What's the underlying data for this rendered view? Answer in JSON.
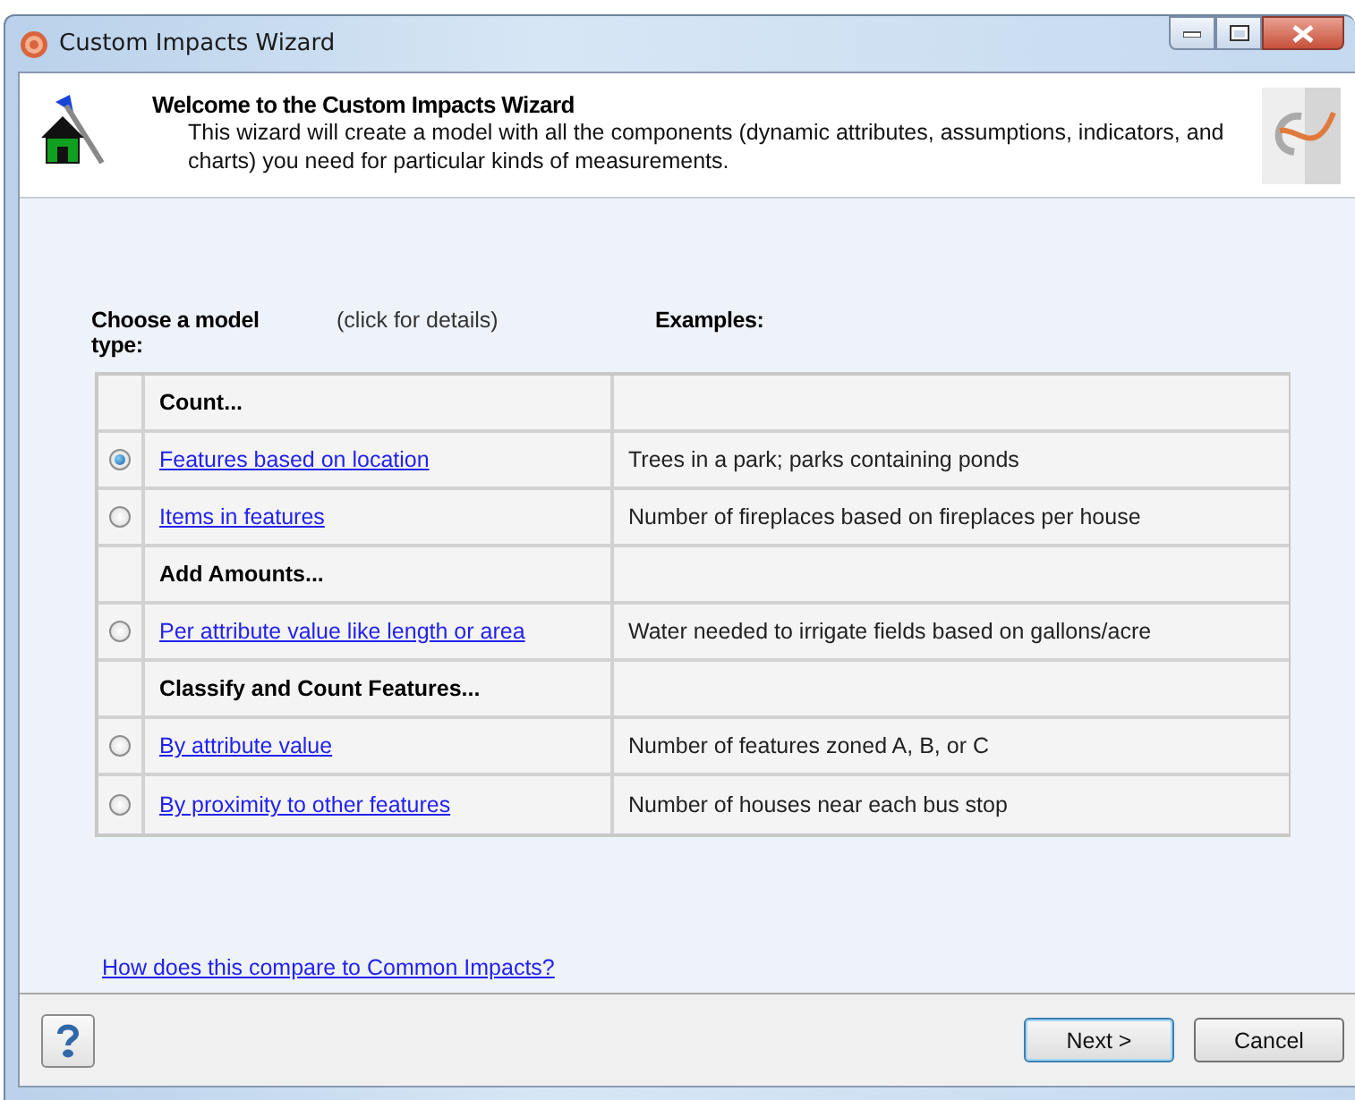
{
  "window": {
    "title": "Custom Impacts Wizard"
  },
  "header": {
    "title": "Welcome to the Custom Impacts Wizard",
    "description": "This wizard will create a model with all the components (dynamic attributes, assumptions, indicators, and charts) you need for particular kinds of measurements."
  },
  "choose_label": "Choose a model type:",
  "hint": "(click for details)",
  "examples_label": "Examples:",
  "rows": [
    {
      "kind": "group",
      "label": "Count..."
    },
    {
      "kind": "option",
      "label": "Features based on location",
      "example": "Trees in a park; parks containing ponds",
      "selected": true
    },
    {
      "kind": "option",
      "label": "Items in features",
      "example": "Number of fireplaces based on fireplaces per house",
      "selected": false
    },
    {
      "kind": "group",
      "label": "Add Amounts..."
    },
    {
      "kind": "option",
      "label": "Per attribute value like length or area",
      "example": "Water needed to irrigate fields based on gallons/acre",
      "selected": false
    },
    {
      "kind": "group",
      "label": "Classify and Count Features..."
    },
    {
      "kind": "option",
      "label": "By attribute value",
      "example": "Number of features zoned A, B, or C",
      "selected": false
    },
    {
      "kind": "option",
      "label": "By proximity to other features",
      "example": "Number of houses near each bus stop",
      "selected": false
    }
  ],
  "compare_link": "How does this compare to Common Impacts?",
  "buttons": {
    "next": "Next >",
    "cancel": "Cancel"
  }
}
